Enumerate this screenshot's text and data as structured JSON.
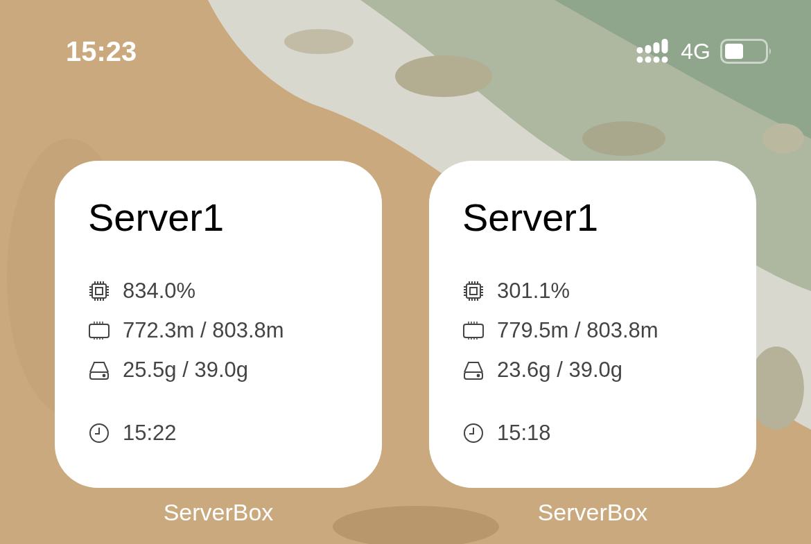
{
  "status_bar": {
    "time": "15:23",
    "network": "4G"
  },
  "widgets": [
    {
      "title": "Server1",
      "stats": [
        {
          "kind": "cpu",
          "value": "834.0%"
        },
        {
          "kind": "memory",
          "value": "772.3m / 803.8m"
        },
        {
          "kind": "disk",
          "value": "25.5g / 39.0g"
        }
      ],
      "updated": "15:22",
      "app_name": "ServerBox"
    },
    {
      "title": "Server1",
      "stats": [
        {
          "kind": "cpu",
          "value": "301.1%"
        },
        {
          "kind": "memory",
          "value": "779.5m / 803.8m"
        },
        {
          "kind": "disk",
          "value": "23.6g / 39.0g"
        }
      ],
      "updated": "15:18",
      "app_name": "ServerBox"
    }
  ]
}
